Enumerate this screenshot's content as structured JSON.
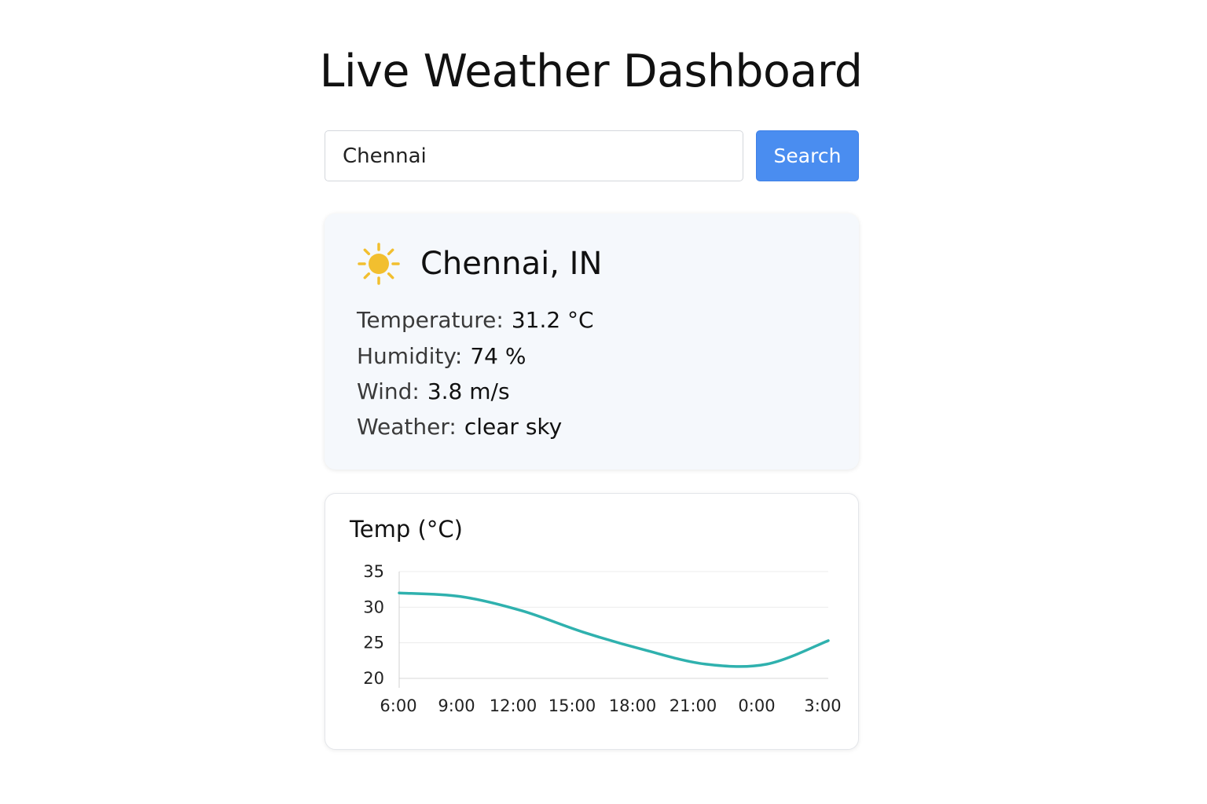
{
  "header": {
    "title": "Live Weather Dashboard"
  },
  "search": {
    "value": "Chennai",
    "button_label": "Search"
  },
  "current": {
    "icon": "sun-icon",
    "location": "Chennai, IN",
    "metrics": {
      "temperature": {
        "label": "Temperature:",
        "value": "31.2 °C"
      },
      "humidity": {
        "label": "Humidity:",
        "value": "74 %"
      },
      "wind": {
        "label": "Wind:",
        "value": "3.8 m/s"
      },
      "weather": {
        "label": "Weather:",
        "value": "clear sky"
      }
    }
  },
  "colors": {
    "accent": "#4a8df0",
    "line": "#2fb1ae",
    "sun": "#f2bf2f",
    "card_bg": "#f5f8fc"
  },
  "chart_data": {
    "type": "line",
    "title": "Temp (°C)",
    "xlabel": "",
    "ylabel": "",
    "x": [
      "6:00",
      "9:00",
      "12:00",
      "15:00",
      "18:00",
      "21:00",
      "0:00",
      "3:00"
    ],
    "series": [
      {
        "values": [
          32.0,
          31.5,
          29.5,
          26.5,
          24.0,
          22.0,
          22.0,
          25.3
        ]
      }
    ],
    "y_ticks": [
      20,
      25,
      30,
      35
    ],
    "ylim": [
      20,
      35
    ],
    "grid": true,
    "legend": "none"
  }
}
